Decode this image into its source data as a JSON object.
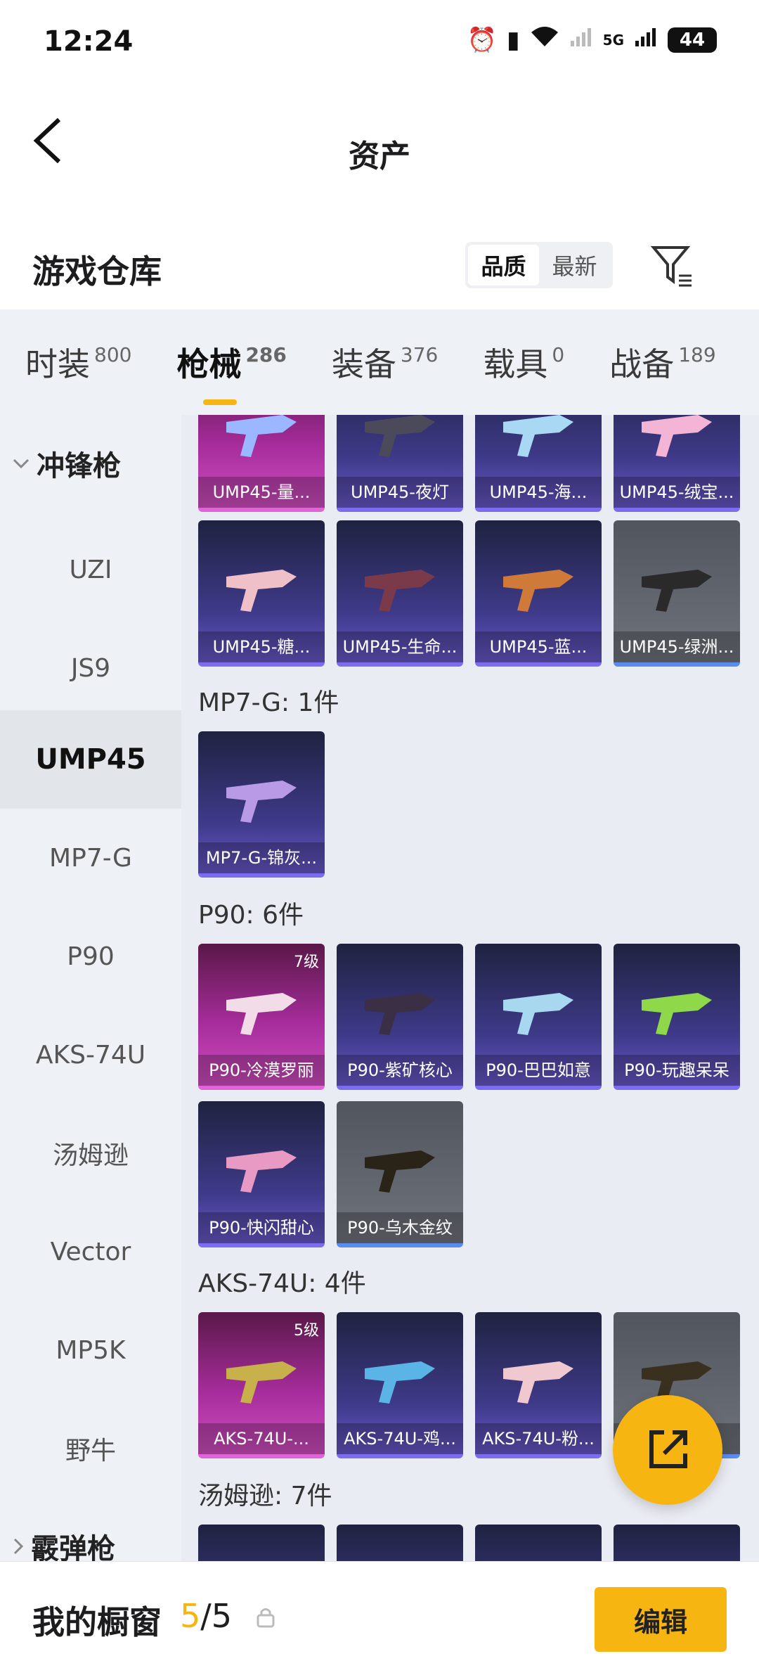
{
  "status": {
    "time": "12:24",
    "battery": "44",
    "network": "5G"
  },
  "header": {
    "title": "资产"
  },
  "warehouse": {
    "title": "游戏仓库",
    "sort": [
      "品质",
      "最新"
    ]
  },
  "tabs": [
    {
      "label": "时装",
      "count": "800"
    },
    {
      "label": "枪械",
      "count": "286"
    },
    {
      "label": "装备",
      "count": "376"
    },
    {
      "label": "载具",
      "count": "0"
    },
    {
      "label": "战备",
      "count": "189"
    }
  ],
  "sidebar": {
    "category": "冲锋枪",
    "items": [
      "UZI",
      "JS9",
      "UMP45",
      "MP7-G",
      "P90",
      "AKS-74U",
      "汤姆逊",
      "Vector",
      "MP5K",
      "野牛"
    ],
    "next_category": "霰弹枪"
  },
  "sections": [
    {
      "title": "",
      "cards": [
        "UMP45-量...",
        "UMP45-夜灯",
        "UMP45-海...",
        "UMP45-绒宝...",
        "UMP45-糖...",
        "UMP45-生命...",
        "UMP45-蓝...",
        "UMP45-绿洲..."
      ]
    },
    {
      "title": "MP7-G: 1件",
      "cards": [
        "MP7-G-锦灰..."
      ]
    },
    {
      "title": "P90: 6件",
      "cards": [
        "P90-冷漠罗丽",
        "P90-紫矿核心",
        "P90-巴巴如意",
        "P90-玩趣呆呆",
        "P90-快闪甜心",
        "P90-乌木金纹"
      ],
      "level": "7级"
    },
    {
      "title": "AKS-74U: 4件",
      "cards": [
        "AKS-74U-...",
        "AKS-74U-鸡...",
        "AKS-74U-粉...",
        "..."
      ],
      "level": "5级"
    },
    {
      "title": "汤姆逊: 7件"
    }
  ],
  "bottom": {
    "label": "我的橱窗",
    "current": "5",
    "total": "/5",
    "edit": "编辑"
  },
  "colors": {
    "accent": "#f7b512"
  }
}
